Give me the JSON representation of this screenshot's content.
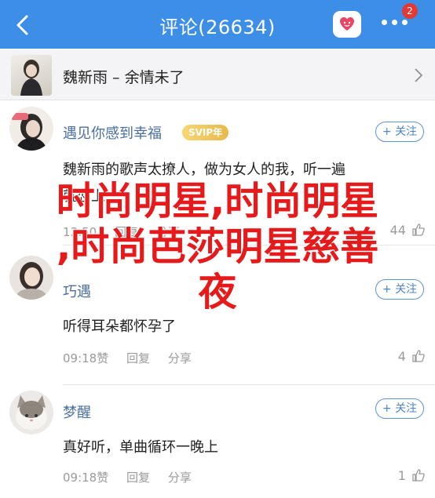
{
  "header": {
    "title": "评论(26634)",
    "badge_count": "2"
  },
  "song": {
    "title": "魏新雨 – 余情未了"
  },
  "comments": [
    {
      "username": "遇见你感到幸福",
      "vip_label": "SVIP年",
      "follow_label": "+ 关注",
      "text": "魏新雨的歌声太撩人，做为女人的我，听一遍",
      "text2": "就恋上",
      "meta": [
        "13:50",
        "回复",
        "分享"
      ],
      "likes": "44"
    },
    {
      "username": "巧遇",
      "follow_label": "+ 关注",
      "text": "听得耳朵都怀孕了",
      "meta": [
        "09:18赞",
        "回复",
        "分享"
      ],
      "likes": "4"
    },
    {
      "username": "梦醒",
      "follow_label": "+ 关注",
      "text": "真好听，单曲循环一晚上",
      "meta": [
        "09:18赞",
        "回复",
        "分享"
      ],
      "likes": "1"
    }
  ],
  "overlay": {
    "text": "时尚明星,时尚明星\n,时尚芭莎明星慈善\n夜"
  },
  "colors": {
    "header_bg": "#3d8ee6",
    "link": "#4a6fa0",
    "overlay": "#e6191b"
  },
  "icons": {
    "back": "chevron-left-icon",
    "heart": "heart-icon",
    "more": "more-icon",
    "chevron": "chevron-right-icon",
    "like": "thumb-up-icon"
  }
}
